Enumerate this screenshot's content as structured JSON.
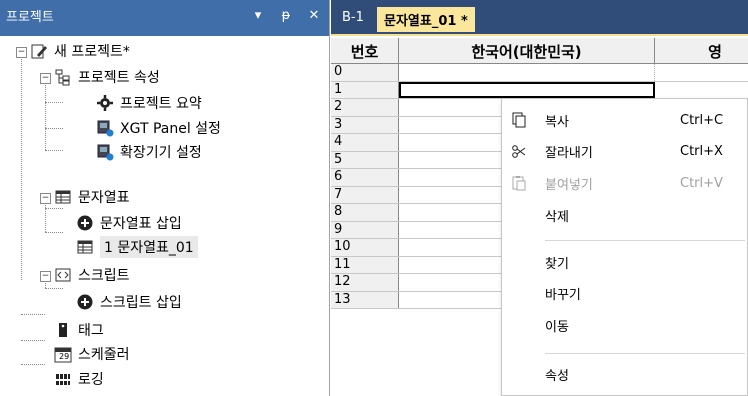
{
  "project_panel": {
    "title": "프로젝트",
    "pin_glyph": "▾",
    "dock_glyph": "ᵽ",
    "close_glyph": "✕",
    "tree": {
      "root": "새 프로젝트*",
      "project_props": "프로젝트 속성",
      "project_summary": "프로젝트 요약",
      "xgt_panel": "XGT Panel 설정",
      "expansion": "확장기기 설정",
      "string_table": "문자열표",
      "insert_string_table": "문자열표 삽입",
      "string_table_01": "1 문자열표_01",
      "script": "스크립트",
      "insert_script": "스크립트 삽입",
      "tag": "태그",
      "scheduler": "스케줄러",
      "logging": "로깅",
      "calendar_day": "29"
    }
  },
  "editor": {
    "tabs": [
      "B-1",
      "문자열표_01 *"
    ],
    "columns": [
      "번호",
      "한국어(대한민국)",
      "영"
    ],
    "row_numbers": [
      "0",
      "1",
      "2",
      "3",
      "4",
      "5",
      "6",
      "7",
      "8",
      "9",
      "10",
      "11",
      "12",
      "13"
    ]
  },
  "context_menu": {
    "copy": {
      "label": "복사",
      "shortcut": "Ctrl+C"
    },
    "cut": {
      "label": "잘라내기",
      "shortcut": "Ctrl+X"
    },
    "paste": {
      "label": "붙여넣기",
      "shortcut": "Ctrl+V"
    },
    "delete": {
      "label": "삭제"
    },
    "find": {
      "label": "찾기"
    },
    "replace": {
      "label": "바꾸기"
    },
    "goto": {
      "label": "이동"
    },
    "properties": {
      "label": "속성"
    }
  },
  "colors": {
    "panel_title_bg": "#3f6ea8",
    "tabbar_bg": "#2f4d78",
    "active_tab_bg": "#fbe79c",
    "accent_blue": "#1e5fb4"
  }
}
